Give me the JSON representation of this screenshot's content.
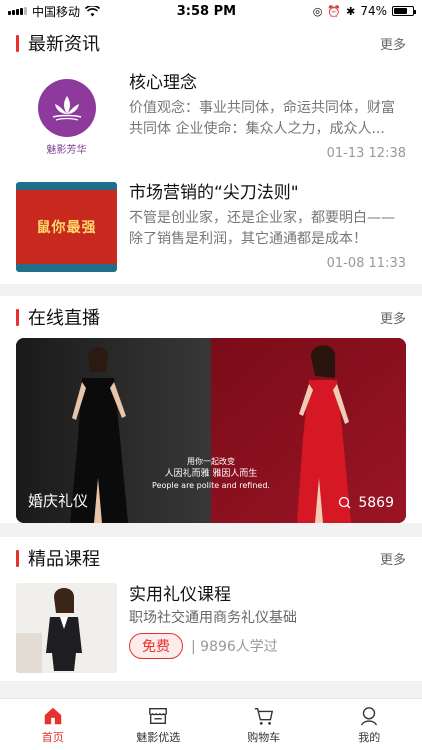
{
  "status": {
    "carrier": "中国移动",
    "time": "3:58 PM",
    "battery": "74%",
    "battery_level": 0.74
  },
  "news": {
    "title": "最新资讯",
    "more": "更多",
    "items": [
      {
        "title": "核心理念",
        "desc": "价值观念：事业共同体，命运共同体，财富共同体 企业使命：集众人之力，成众人...",
        "time": "01-13 12:38",
        "thumb_text": "魅影芳华"
      },
      {
        "title": "市场营销的“尖刀法则\"",
        "desc": "不管是创业家，还是企业家，都要明白——除了销售是利润，其它通通都是成本！",
        "time": "01-08 11:33",
        "thumb_text": "鼠你最强"
      }
    ]
  },
  "live": {
    "title": "在线直播",
    "more": "更多",
    "card": {
      "label": "婚庆礼仪",
      "count": "5869",
      "caption_line1": "用你一起改变",
      "caption_line2": "人因礼而雅 雅因人而生",
      "caption_line3": "People are polite and refined."
    }
  },
  "courses": {
    "title": "精品课程",
    "more": "更多",
    "items": [
      {
        "title": "实用礼仪课程",
        "subtitle": "职场社交通用商务礼仪基础",
        "badge": "免费",
        "learners": "| 9896人学过"
      }
    ]
  },
  "tabbar": [
    {
      "label": "首页",
      "icon": "home-icon",
      "active": true
    },
    {
      "label": "魅影优选",
      "icon": "store-icon",
      "active": false
    },
    {
      "label": "购物车",
      "icon": "cart-icon",
      "active": false
    },
    {
      "label": "我的",
      "icon": "user-icon",
      "active": false
    }
  ],
  "colors": {
    "accent": "#e5322d"
  }
}
